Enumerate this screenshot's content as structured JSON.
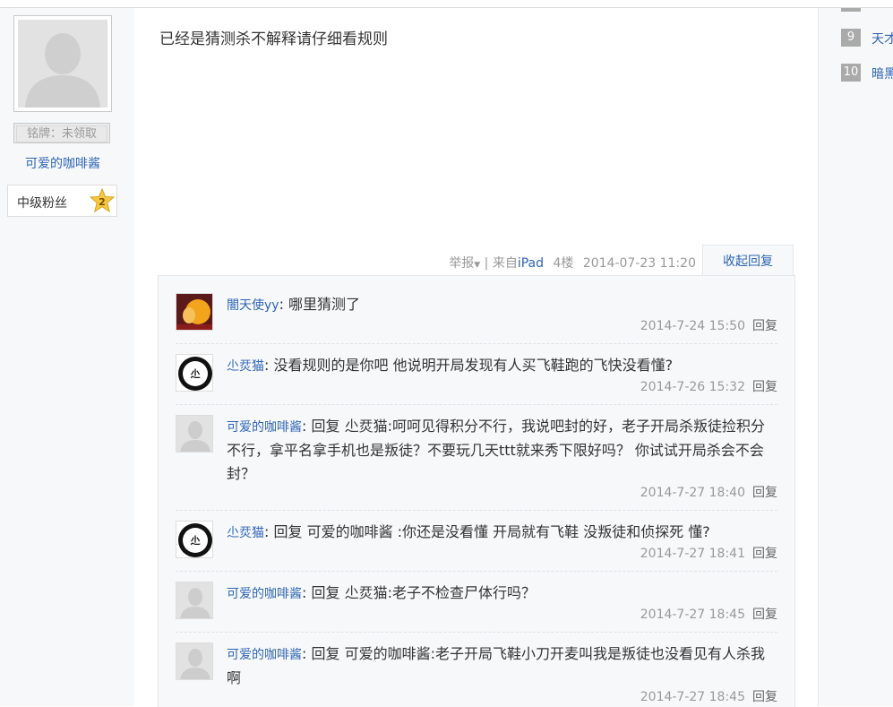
{
  "profile": {
    "badge_label": "铭牌：未领取",
    "username": "可爱的咖啡酱",
    "level_title": "中级粉丝",
    "level_number": "2"
  },
  "sidebar_right": {
    "items": [
      {
        "rank": "9",
        "text": "天才"
      },
      {
        "rank": "10",
        "text": "暗黑"
      }
    ]
  },
  "post": {
    "content": "已经是猜测杀不解释请仔细看规则",
    "report_label": "举报",
    "source_prefix": "来自",
    "source_device": "iPad",
    "floor": "4楼",
    "timestamp": "2014-07-23 11:20",
    "collapse_label": "收起回复"
  },
  "replies": [
    {
      "author": "闇天使yy",
      "text": ": 哪里猜测了",
      "time": "2014-7-24 15:50",
      "reply_label": "回复"
    },
    {
      "author": "尐烎猫",
      "text": ": 没看规则的是你吧 他说明开局发现有人买飞鞋跑的飞快没看懂?",
      "time": "2014-7-26 15:32",
      "reply_label": "回复"
    },
    {
      "author": "可爱的咖啡酱",
      "text": ": 回复 尐烎猫:呵呵见得积分不行，我说吧封的好，老子开局杀叛徒捡积分不行，拿平名拿手机也是叛徒？不要玩几天ttt就来秀下限好吗？ 你试试开局杀会不会封？",
      "time": "2014-7-27 18:40",
      "reply_label": "回复"
    },
    {
      "author": "尐烎猫",
      "text": ": 回复 可爱的咖啡酱 :你还是没看懂 开局就有飞鞋 没叛徒和侦探死 懂?",
      "time": "2014-7-27 18:41",
      "reply_label": "回复"
    },
    {
      "author": "可爱的咖啡酱",
      "text": ": 回复 尐烎猫:老子不检查尸体行吗？",
      "time": "2014-7-27 18:45",
      "reply_label": "回复"
    },
    {
      "author": "可爱的咖啡酱",
      "text": ": 回复 可爱的咖啡酱:老子开局飞鞋小刀开麦叫我是叛徒也没看见有人杀我啊",
      "time": "2014-7-27 18:45",
      "reply_label": "回复"
    }
  ]
}
